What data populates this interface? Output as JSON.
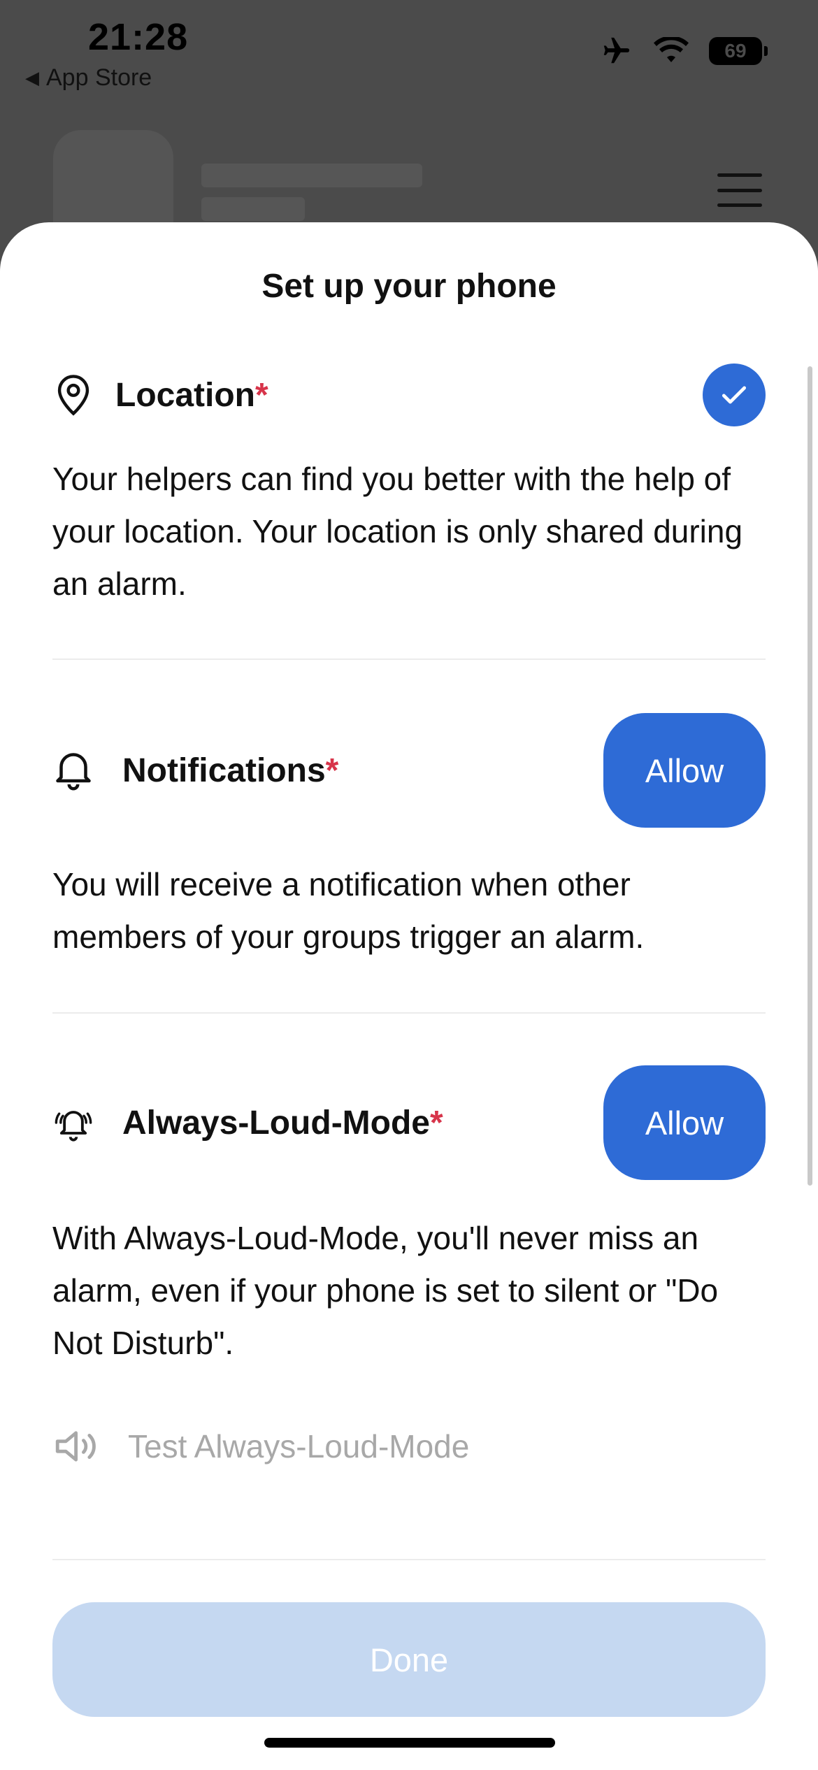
{
  "status_bar": {
    "time": "21:28",
    "back_label": "App Store",
    "battery": "69"
  },
  "sheet": {
    "title": "Set up your phone",
    "location": {
      "label": "Location",
      "required_mark": "*",
      "description": "Your helpers can find you better with the help of your location. Your location is only shared during an alarm.",
      "status": "granted"
    },
    "notifications": {
      "label": "Notifications",
      "required_mark": "*",
      "button_label": "Allow",
      "description": "You will receive a notification when other members of your groups trigger an alarm."
    },
    "always_loud": {
      "label": "Always-Loud-Mode",
      "required_mark": "*",
      "button_label": "Allow",
      "description": "With Always-Loud-Mode, you'll never miss an alarm, even if your phone is set to silent or \"Do Not Disturb\".",
      "test_label": "Test Always-Loud-Mode"
    },
    "done_label": "Done"
  },
  "colors": {
    "accent": "#2e6bd6",
    "required": "#d7344a",
    "done_disabled": "#c5d8f1",
    "muted_text": "#a8a8a8"
  },
  "icons": [
    "location-pin-icon",
    "bell-icon",
    "ringing-bell-icon",
    "speaker-icon",
    "checkmark-icon",
    "airplane-icon",
    "wifi-icon",
    "hamburger-menu-icon"
  ]
}
